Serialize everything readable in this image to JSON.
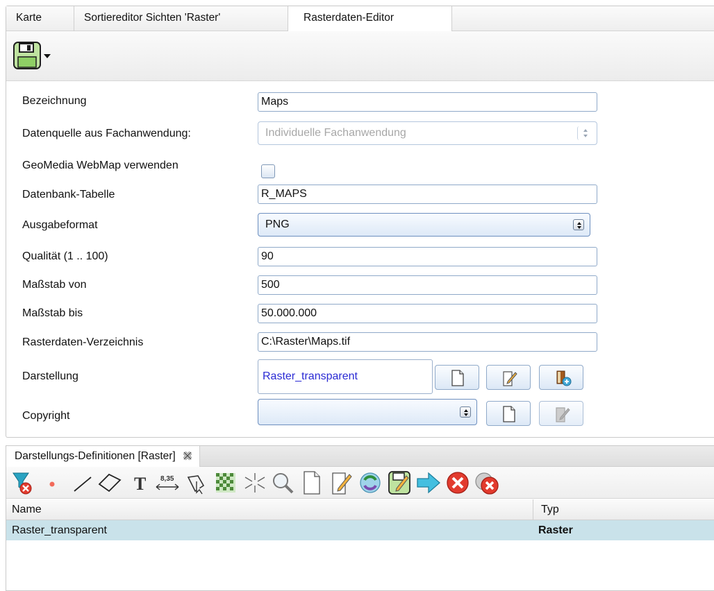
{
  "tabs": [
    {
      "label": "Karte"
    },
    {
      "label": "Sortiereditor Sichten 'Raster'"
    },
    {
      "label": "Rasterdaten-Editor"
    }
  ],
  "form": {
    "bezeichnung": {
      "label": "Bezeichnung",
      "value": "Maps"
    },
    "datenquelle": {
      "label": "Datenquelle aus Fachanwendung:",
      "value": "Individuelle Fachanwendung"
    },
    "geomedia": {
      "label": "GeoMedia WebMap verwenden",
      "checked": false
    },
    "tabelle": {
      "label": "Datenbank-Tabelle",
      "value": "R_MAPS"
    },
    "ausgabeformat": {
      "label": "Ausgabeformat",
      "value": "PNG"
    },
    "qualitaet": {
      "label": "Qualität (1 .. 100)",
      "value": "90"
    },
    "massstab_von": {
      "label": "Maßstab von",
      "value": "500"
    },
    "massstab_bis": {
      "label": "Maßstab bis",
      "value": "50.000.000"
    },
    "verzeichnis": {
      "label": "Rasterdaten-Verzeichnis",
      "value": "C:\\Raster\\Maps.tif"
    },
    "darstellung": {
      "label": "Darstellung",
      "value": "Raster_transparent"
    },
    "copyright": {
      "label": "Copyright",
      "value": ""
    }
  },
  "bottom": {
    "tab_label": "Darstellungs-Definitionen [Raster]",
    "grid": {
      "columns": [
        "Name",
        "Typ"
      ],
      "rows": [
        {
          "name": "Raster_transparent",
          "typ": "Raster"
        }
      ]
    }
  },
  "icons": {
    "save": "floppy-disk-icon",
    "toolbar": [
      "filter-remove-icon",
      "point-icon",
      "line-icon",
      "polygon-icon",
      "text-icon",
      "dimension-icon",
      "select-polygon-icon",
      "raster-pattern-icon",
      "split-icon",
      "zoom-icon",
      "new-document-icon",
      "edit-icon",
      "refresh-icon",
      "save-icon",
      "forward-icon",
      "delete-icon",
      "delete-all-icon"
    ]
  }
}
